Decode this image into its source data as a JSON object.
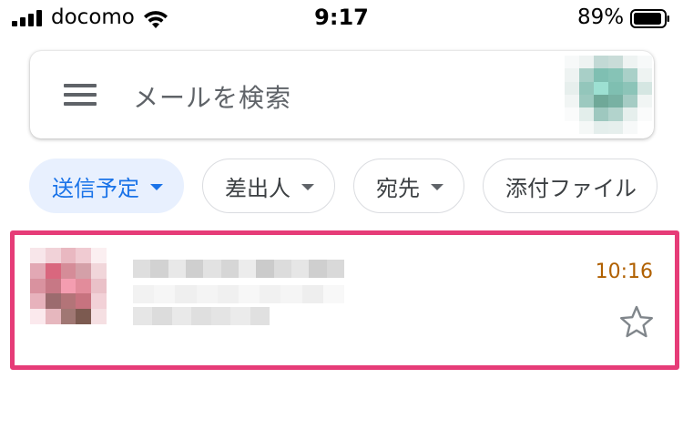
{
  "status_bar": {
    "carrier": "docomo",
    "time": "9:17",
    "battery_percent": "89%",
    "icons": [
      "signal-bars-icon",
      "wifi-icon",
      "battery-icon"
    ]
  },
  "search": {
    "placeholder": "メールを検索",
    "menu_icon": "hamburger-menu-icon",
    "avatar": "profile-avatar-pixelated"
  },
  "filters": [
    {
      "label": "送信予定",
      "active": true
    },
    {
      "label": "差出人",
      "active": false
    },
    {
      "label": "宛先",
      "active": false
    },
    {
      "label": "添付ファイル",
      "active": false
    }
  ],
  "mail_list": [
    {
      "time": "10:16",
      "starred": false,
      "avatar": "pixelated-avatar",
      "star_icon": "star-outline-icon"
    }
  ],
  "colors": {
    "highlight_border": "#e63c78",
    "active_chip_bg": "#e8f0fe",
    "active_chip_text": "#1a73e8",
    "mail_time": "#b06000"
  }
}
